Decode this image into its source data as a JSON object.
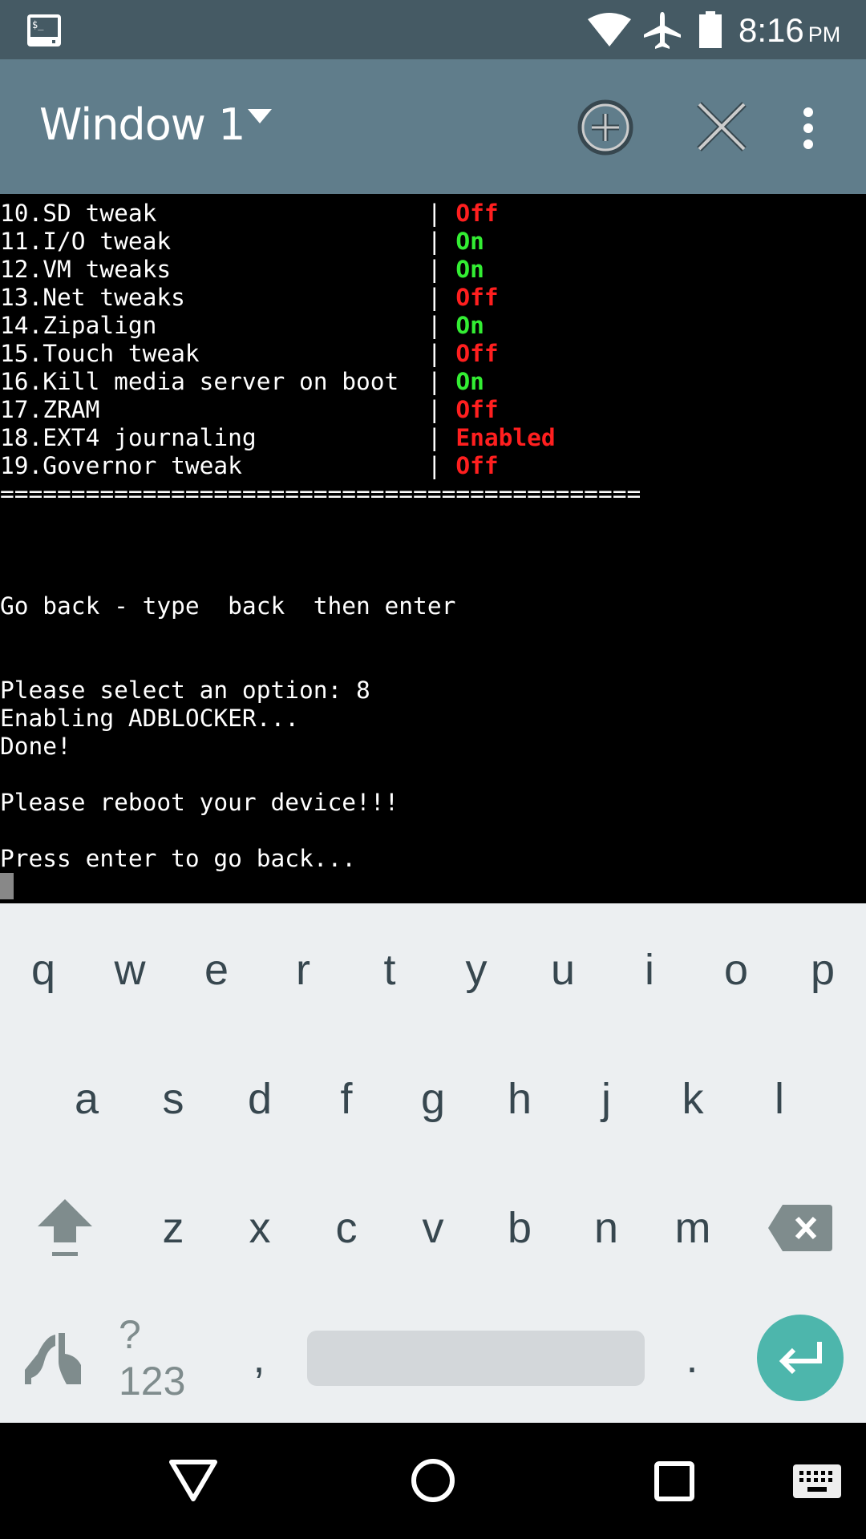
{
  "status_bar": {
    "time": "8:16",
    "ampm": "PM",
    "icons": [
      "terminal-icon",
      "wifi-icon",
      "airplane-mode-icon",
      "battery-icon"
    ]
  },
  "toolbar": {
    "title": "Window 1",
    "icons": [
      "dropdown-arrow-icon",
      "add-window-icon",
      "close-window-icon",
      "more-options-icon"
    ]
  },
  "terminal": {
    "rows": [
      {
        "label": "10.SD tweak",
        "status": "Off",
        "state": "red"
      },
      {
        "label": "11.I/O tweak",
        "status": "On",
        "state": "green"
      },
      {
        "label": "12.VM tweaks",
        "status": "On",
        "state": "green"
      },
      {
        "label": "13.Net tweaks",
        "status": "Off",
        "state": "red"
      },
      {
        "label": "14.Zipalign",
        "status": "On",
        "state": "green"
      },
      {
        "label": "15.Touch tweak",
        "status": "Off",
        "state": "red"
      },
      {
        "label": "16.Kill media server on boot",
        "status": "On",
        "state": "green"
      },
      {
        "label": "17.ZRAM",
        "status": "Off",
        "state": "red"
      },
      {
        "label": "18.EXT4 journaling",
        "status": "Enabled",
        "state": "red"
      },
      {
        "label": "19.Governor tweak",
        "status": "Off",
        "state": "red"
      }
    ],
    "separator": "=============================================",
    "lines": [
      "",
      "",
      "",
      "Go back - type  back  then enter",
      "",
      "",
      "Please select an option: 8",
      "Enabling ADBLOCKER...",
      "Done!",
      "",
      "Please reboot your device!!!",
      "",
      "Press enter to go back..."
    ],
    "colors": {
      "on": "#33ee33",
      "off": "#ff1f1f"
    }
  },
  "keyboard": {
    "row1": [
      "q",
      "w",
      "e",
      "r",
      "t",
      "y",
      "u",
      "i",
      "o",
      "p"
    ],
    "row2": [
      "a",
      "s",
      "d",
      "f",
      "g",
      "h",
      "j",
      "k",
      "l"
    ],
    "row3": [
      "z",
      "x",
      "c",
      "v",
      "b",
      "n",
      "m"
    ],
    "symbols": "?123",
    "comma": ",",
    "period": ".",
    "enter_color": "#4db6ac"
  },
  "nav_bar": {
    "icons": [
      "back-icon",
      "home-icon",
      "recents-icon",
      "keyboard-switch-icon"
    ]
  }
}
